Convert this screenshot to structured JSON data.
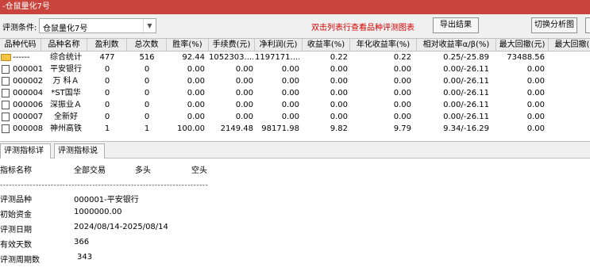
{
  "window": {
    "title": "-仓鼠量化7号"
  },
  "toolbar": {
    "condition_label": "评测条件:",
    "condition_value": "仓鼠量化7号",
    "hint": "双击列表行查看品种评测图表",
    "export_label": "导出结果",
    "switch_label": "切换分析图"
  },
  "table": {
    "columns": [
      "品种代码",
      "品种名称",
      "盈利数",
      "总次数",
      "胜率(%)",
      "手续费(元)",
      "净利润(元)",
      "收益率(%)",
      "年化收益率(%)",
      "相对收益率α/β(%)",
      "最大回撤(元)",
      "最大回撤("
    ],
    "rows": [
      {
        "icon": "folder-icon",
        "code": "------",
        "name": "综合统计",
        "wins": "477",
        "total": "516",
        "winrate": "92.44",
        "fee": "1052303....",
        "profit": "1197171....",
        "ret": "0.22",
        "annual": "0.22",
        "rel": "0.25/-25.89",
        "maxdd": "73488.56"
      },
      {
        "icon": "doc-icon",
        "code": "000001",
        "name": "平安银行",
        "wins": "0",
        "total": "0",
        "winrate": "0.00",
        "fee": "0.00",
        "profit": "0.00",
        "ret": "0.00",
        "annual": "0.00",
        "rel": "0.00/-26.11",
        "maxdd": "0.00"
      },
      {
        "icon": "doc-icon",
        "code": "000002",
        "name": "万 科Ａ",
        "wins": "0",
        "total": "0",
        "winrate": "0.00",
        "fee": "0.00",
        "profit": "0.00",
        "ret": "0.00",
        "annual": "0.00",
        "rel": "0.00/-26.11",
        "maxdd": "0.00"
      },
      {
        "icon": "doc-icon",
        "code": "000004",
        "name": "*ST国华",
        "wins": "0",
        "total": "0",
        "winrate": "0.00",
        "fee": "0.00",
        "profit": "0.00",
        "ret": "0.00",
        "annual": "0.00",
        "rel": "0.00/-26.11",
        "maxdd": "0.00"
      },
      {
        "icon": "doc-icon",
        "code": "000006",
        "name": "深振业Ａ",
        "wins": "0",
        "total": "0",
        "winrate": "0.00",
        "fee": "0.00",
        "profit": "0.00",
        "ret": "0.00",
        "annual": "0.00",
        "rel": "0.00/-26.11",
        "maxdd": "0.00"
      },
      {
        "icon": "doc-icon",
        "code": "000007",
        "name": "全新好",
        "wins": "0",
        "total": "0",
        "winrate": "0.00",
        "fee": "0.00",
        "profit": "0.00",
        "ret": "0.00",
        "annual": "0.00",
        "rel": "0.00/-26.11",
        "maxdd": "0.00"
      },
      {
        "icon": "doc-icon",
        "code": "000008",
        "name": "神州高铁",
        "wins": "1",
        "total": "1",
        "winrate": "100.00",
        "fee": "2149.48",
        "profit": "98171.98",
        "ret": "9.82",
        "annual": "9.79",
        "rel": "9.34/-16.29",
        "maxdd": "0.00"
      }
    ]
  },
  "tabs": [
    "评测指标详情",
    "评测指标说明"
  ],
  "detail": {
    "headers": [
      "指标名称",
      "全部交易",
      "多头",
      "空头"
    ],
    "separator": "----------------------------------------------------------------------",
    "items": [
      {
        "label": "评测品种",
        "value": "000001-平安银行"
      },
      {
        "label": "初始资金",
        "value": "1000000.00"
      },
      {
        "label": "评测日期",
        "value": "2024/08/14-2025/08/14"
      },
      {
        "label": "有效天数",
        "value": "366"
      },
      {
        "label": "评测周期数",
        "value": "343"
      }
    ]
  }
}
